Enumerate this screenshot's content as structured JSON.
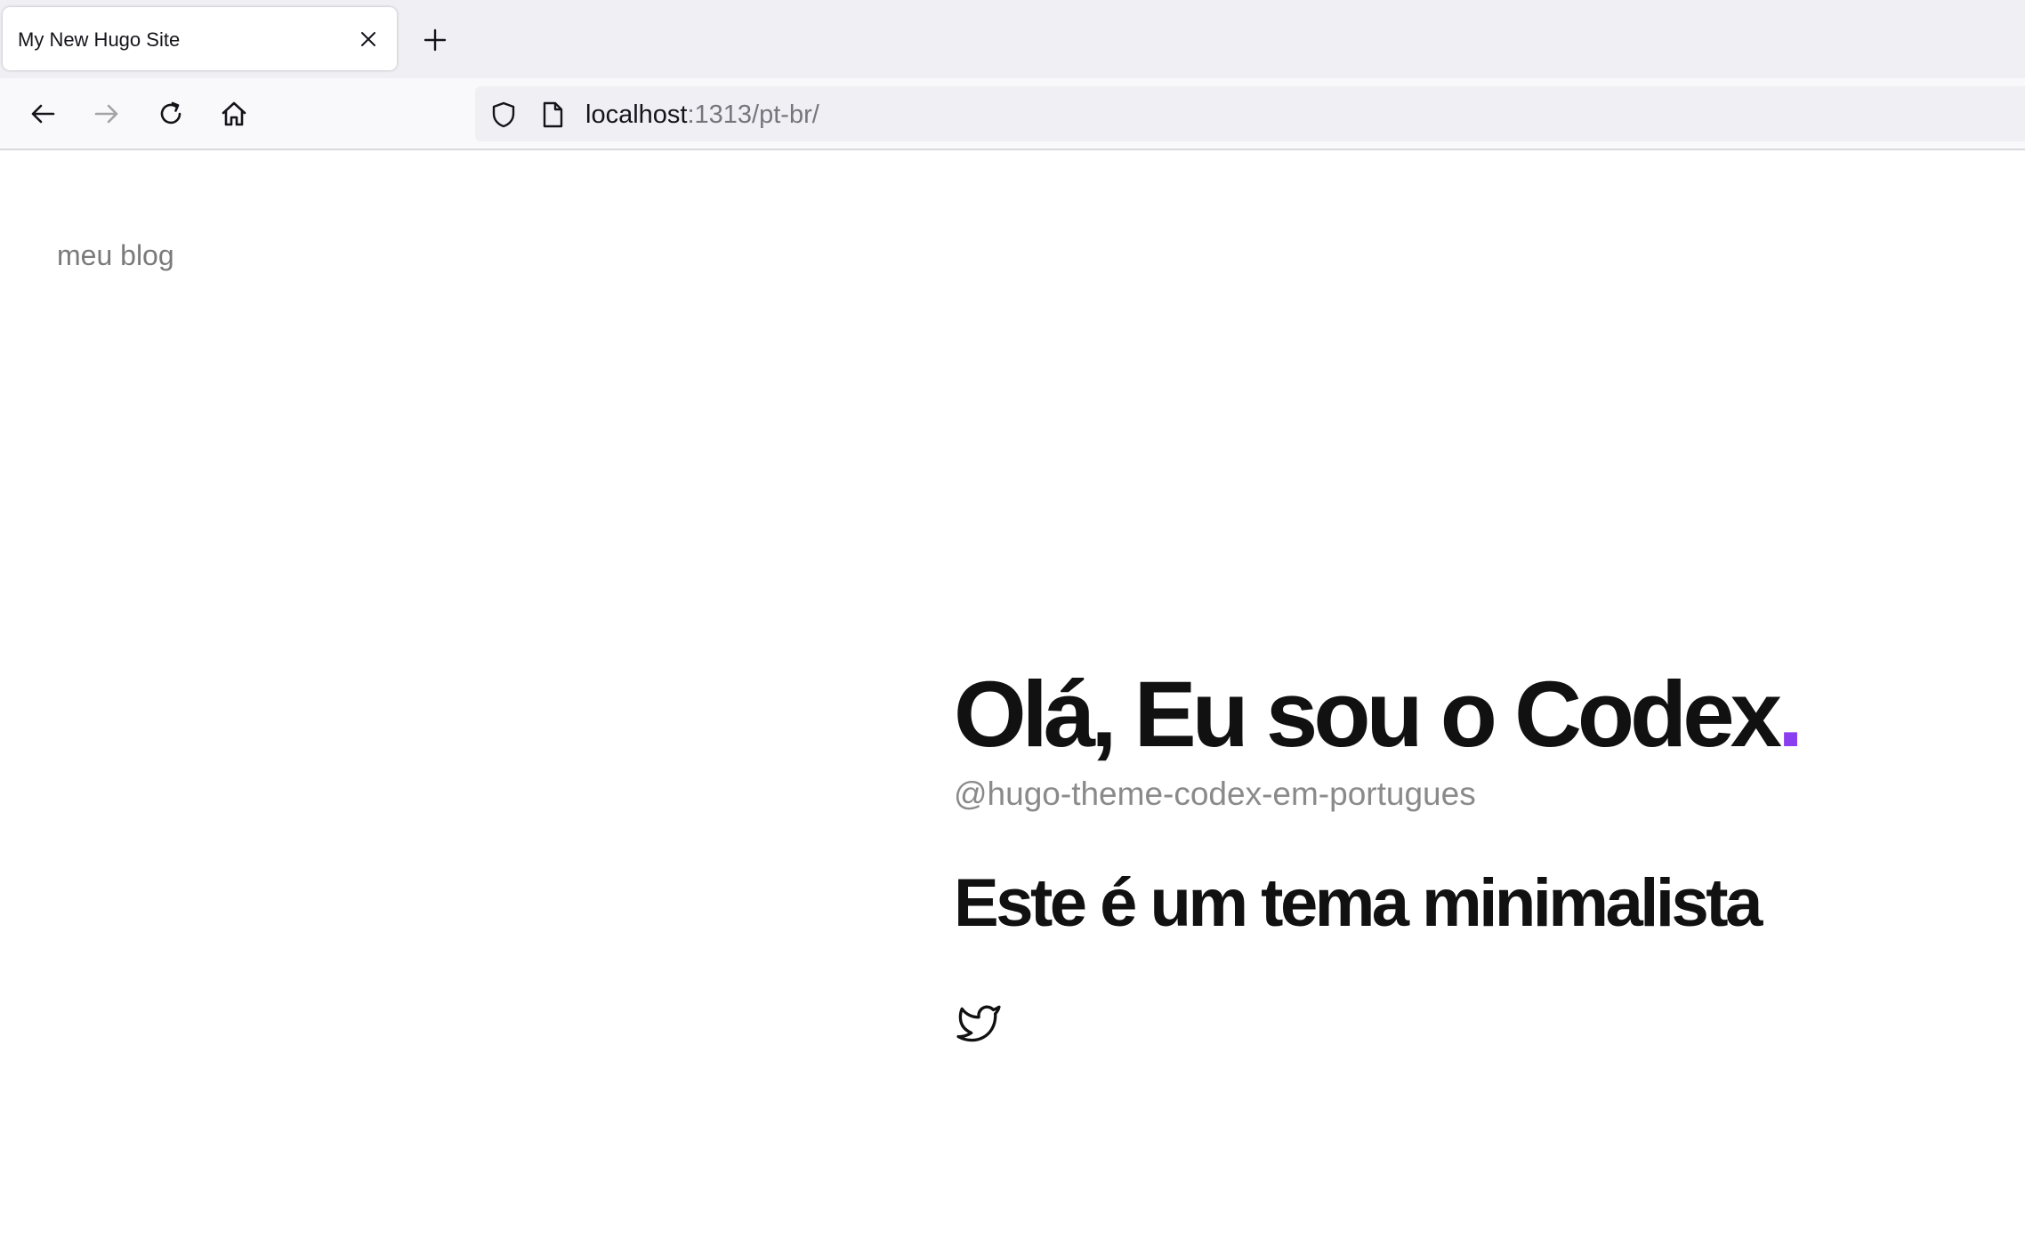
{
  "browser": {
    "tab": {
      "title": "My New Hugo Site",
      "close_icon": "close-icon"
    },
    "new_tab_icon": "plus-icon",
    "nav": {
      "back_icon": "arrow-left-icon",
      "forward_icon": "arrow-right-icon",
      "reload_icon": "reload-icon",
      "home_icon": "home-icon"
    },
    "address_bar": {
      "host": "localhost",
      "path": ":1313/pt-br/",
      "shield_icon": "shield-icon",
      "page_icon": "document-icon"
    }
  },
  "page": {
    "site_title": "meu blog",
    "hero": {
      "heading": "Olá, Eu sou o Codex",
      "heading_dot": ".",
      "handle": "@hugo-theme-codex-em-portugues",
      "tagline": "Este é um tema minimalista"
    },
    "social_links": [
      {
        "icon": "twitter-icon"
      }
    ]
  },
  "colors": {
    "accent": "#8b3df0",
    "text": "#111111",
    "muted": "#8a8a8a",
    "chrome_background": "#f0f0f4"
  }
}
